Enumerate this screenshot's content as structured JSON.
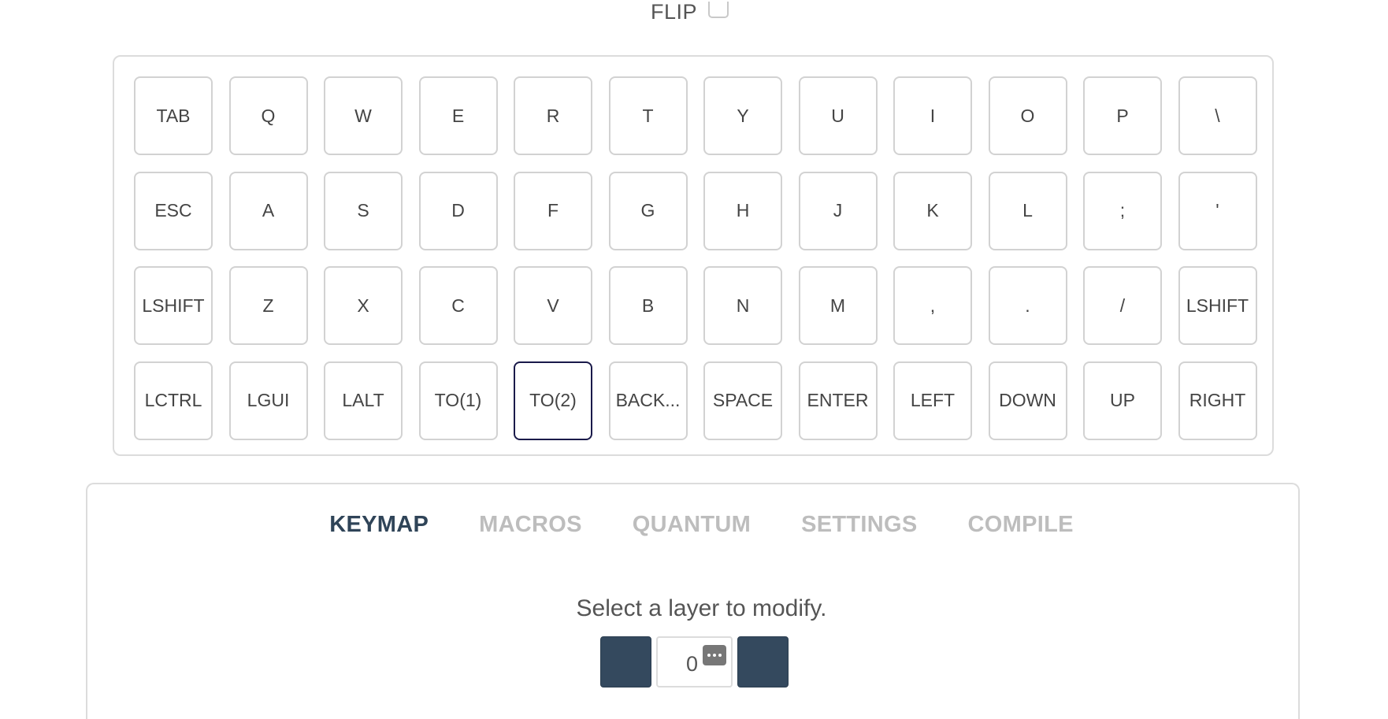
{
  "flip": {
    "label": "FLIP",
    "checked": false
  },
  "keyboard": {
    "rows": [
      [
        "TAB",
        "Q",
        "W",
        "E",
        "R",
        "T",
        "Y",
        "U",
        "I",
        "O",
        "P",
        "\\"
      ],
      [
        "ESC",
        "A",
        "S",
        "D",
        "F",
        "G",
        "H",
        "J",
        "K",
        "L",
        ";",
        "'"
      ],
      [
        "LSHIFT",
        "Z",
        "X",
        "C",
        "V",
        "B",
        "N",
        "M",
        ",",
        ".",
        "/",
        "LSHIFT"
      ],
      [
        "LCTRL",
        "LGUI",
        "LALT",
        "TO(1)",
        "TO(2)",
        "BACK...",
        "SPACE",
        "ENTER",
        "LEFT",
        "DOWN",
        "UP",
        "RIGHT"
      ]
    ],
    "selected_key": "TO(2)"
  },
  "tabs": [
    {
      "label": "KEYMAP",
      "active": true
    },
    {
      "label": "MACROS",
      "active": false
    },
    {
      "label": "QUANTUM",
      "active": false
    },
    {
      "label": "SETTINGS",
      "active": false
    },
    {
      "label": "COMPILE",
      "active": false
    }
  ],
  "layer": {
    "prompt": "Select a layer to modify.",
    "value": "0"
  },
  "colors": {
    "accent": "#34495e",
    "active_tab": "#2f4458",
    "inactive_tab": "#bdbdbd",
    "selected_key_border": "#1a1a4a"
  }
}
